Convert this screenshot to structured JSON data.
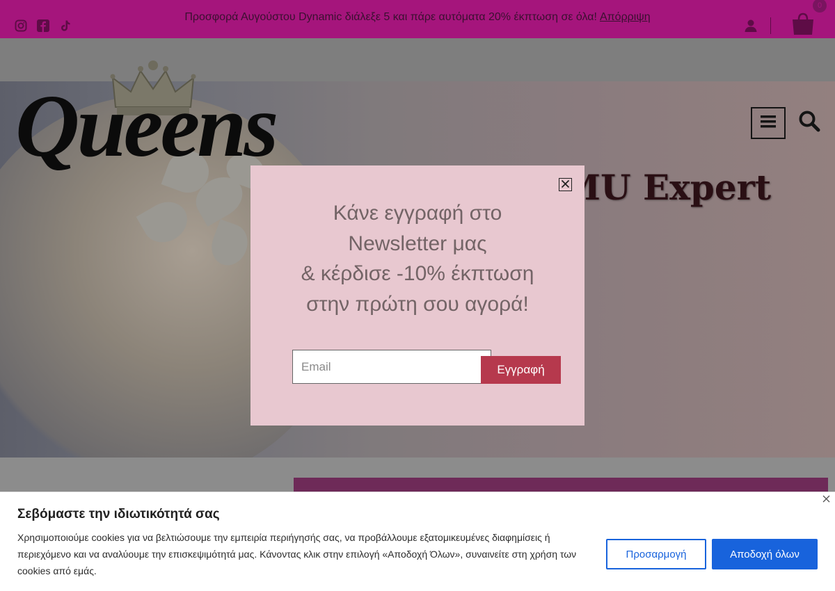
{
  "promo": {
    "text": "Προσφορά Αυγούστου Dynamic διάλεξε 5 και πάρε αυτόματα 20% έκπτωση σε όλα!",
    "dismiss_label": "Απόρριψη",
    "social_icons": [
      "instagram-icon",
      "facebook-icon",
      "tiktok-icon"
    ],
    "cart_count": "0",
    "background": "#a5157c"
  },
  "brand": {
    "logo_text": "Queens"
  },
  "hero": {
    "title": "PMU Expert"
  },
  "newsletter": {
    "lines": [
      "Κάνε εγγραφή στο",
      "Newsletter μας",
      "& κέρδισε -10% έκπτωση",
      "στην πρώτη σου αγορά!"
    ],
    "email_placeholder": "Email",
    "email_value": "",
    "submit_label": "Εγγραφή",
    "background": "#e8c8d0",
    "button_color": "#b6394d"
  },
  "cookie": {
    "title": "Σεβόμαστε την ιδιωτικότητά σας",
    "text": "Χρησιμοποιούμε cookies για να βελτιώσουμε την εμπειρία περιήγησής σας, να προβάλλουμε εξατομικευμένες διαφημίσεις ή περιεχόμενο και να αναλύουμε την επισκεψιμότητά μας. Κάνοντας κλικ στην επιλογή «Αποδοχή Όλων», συναινείτε στη χρήση των cookies από εμάς.",
    "customize_label": "Προσαρμογή",
    "accept_label": "Αποδοχή όλων",
    "accent": "#1863dc"
  }
}
